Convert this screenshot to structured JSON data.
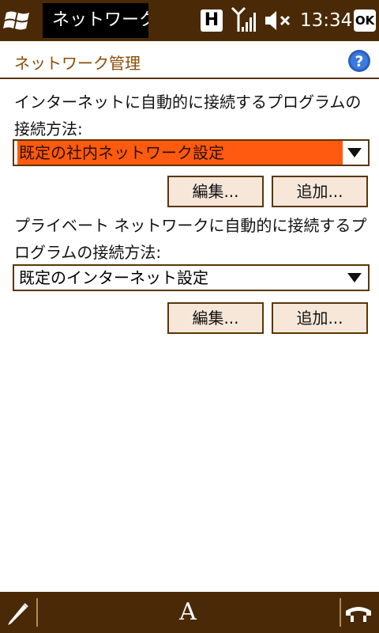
{
  "statusbar": {
    "title": "ネットワーク管",
    "h_label": "H",
    "time": "13:34",
    "ok_label": "OK"
  },
  "header": {
    "title": "ネットワーク管理",
    "help_label": "?"
  },
  "internet": {
    "label": "インターネットに自動的に接続するプログラムの接続方法:",
    "selected": "既定の社内ネットワーク設定",
    "edit_label": "編集...",
    "add_label": "追加..."
  },
  "private": {
    "label": "プライベート ネットワークに自動的に接続するプログラムの接続方法:",
    "selected": "既定のインターネット設定",
    "edit_label": "編集...",
    "add_label": "追加..."
  },
  "bottombar": {
    "keyboard_label": "A"
  },
  "colors": {
    "bar": "#4a2a06",
    "accent": "#8a4e08",
    "selection": "#ff5a10",
    "button_bg": "#f7e7d9"
  }
}
